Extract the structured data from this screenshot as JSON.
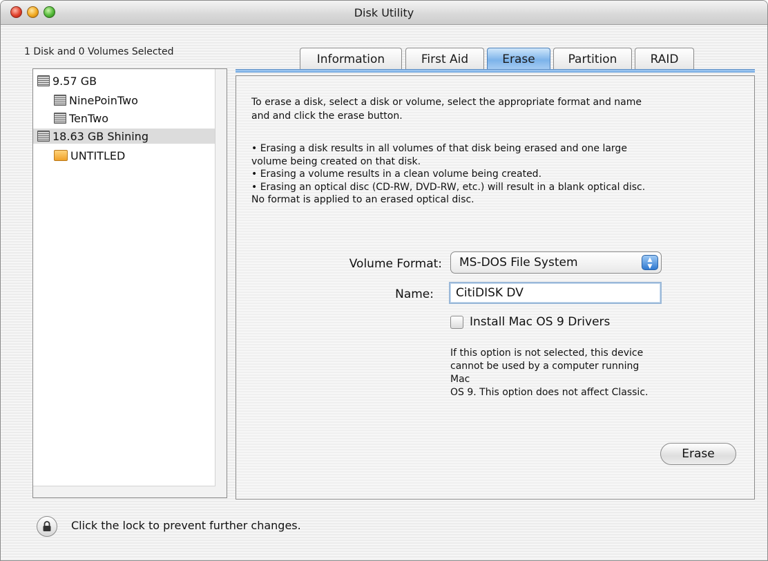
{
  "window": {
    "title": "Disk Utility"
  },
  "selection_label": "1 Disk and 0 Volumes Selected",
  "sidebar": {
    "items": [
      {
        "label": "9.57 GB",
        "kind": "disk",
        "level": 0,
        "selected": false
      },
      {
        "label": "NinePoinTwo",
        "kind": "disk",
        "level": 1,
        "selected": false
      },
      {
        "label": "TenTwo",
        "kind": "disk",
        "level": 1,
        "selected": false
      },
      {
        "label": "18.63 GB Shining",
        "kind": "disk",
        "level": 0,
        "selected": true
      },
      {
        "label": "UNTITLED",
        "kind": "volume",
        "level": 1,
        "selected": false
      }
    ]
  },
  "tabs": [
    {
      "label": "Information"
    },
    {
      "label": "First Aid"
    },
    {
      "label": "Erase",
      "active": true
    },
    {
      "label": "Partition"
    },
    {
      "label": "RAID"
    }
  ],
  "erase_panel": {
    "intro_line1": "To erase a disk, select a disk or volume, select the appropriate format and name",
    "intro_line2": "and and click the erase button.",
    "bullet1_line1": "• Erasing a disk results in all volumes of that disk being erased and one large",
    "bullet1_line2": "volume being created on that disk.",
    "bullet2": "• Erasing a volume results in a clean volume being created.",
    "bullet3_line1": "• Erasing an optical disc (CD-RW, DVD-RW, etc.) will result in a blank optical disc.",
    "bullet3_line2": "No format is applied to an erased optical disc.",
    "volume_format_label": "Volume Format:",
    "volume_format_value": "MS-DOS File System",
    "name_label": "Name:",
    "name_value": "CitiDISK DV",
    "os9_drivers_label": "Install Mac OS 9 Drivers",
    "os9_drivers_checked": false,
    "note_line1": "If this option is not selected, this device",
    "note_line2": "cannot be used by a computer running Mac",
    "note_line3": "OS 9.  This option does not affect Classic.",
    "erase_button": "Erase"
  },
  "lock": {
    "text": "Click the lock to prevent further changes."
  },
  "icons": {
    "lock": "lock-icon",
    "disk": "hard-disk-icon",
    "volume": "volume-icon",
    "popup": "up-down-arrows-icon"
  },
  "colors": {
    "tab_active": "#7db3ea",
    "selection": "#dcdcdc"
  }
}
